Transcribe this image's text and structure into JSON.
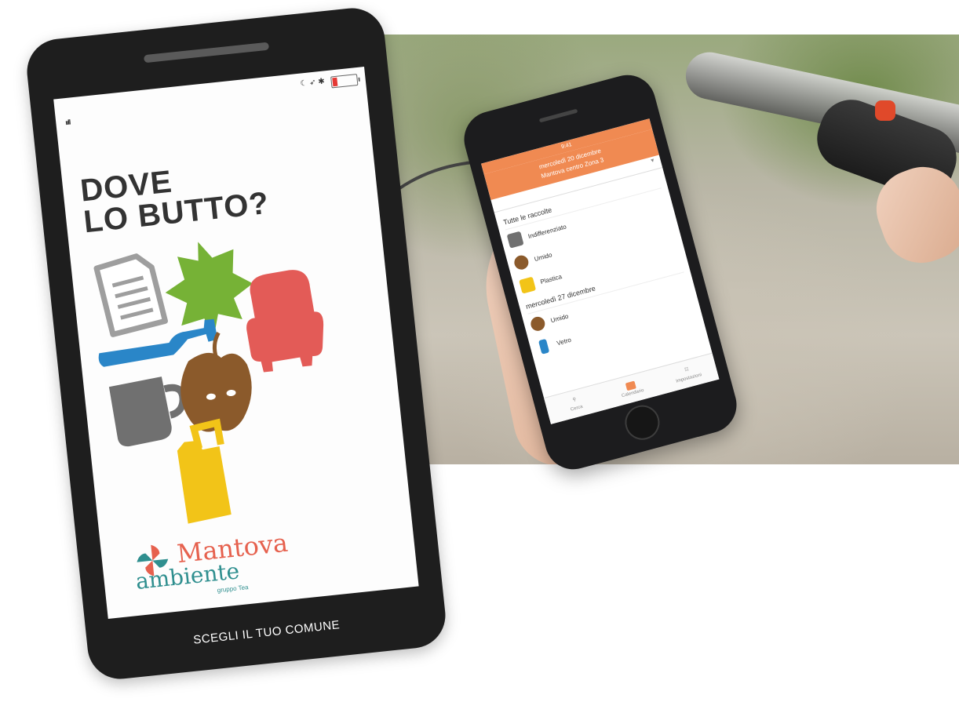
{
  "big_phone": {
    "signal": "ııll",
    "status_icons": "☾ ➶ ✱",
    "title_line1": "DOVE",
    "title_line2": "LO BUTTO?",
    "illustration": {
      "paper": "#9e9e9e",
      "leaf": "#76b236",
      "armchair": "#e35b57",
      "bottle": "#2a86c8",
      "mug": "#707070",
      "apple": "#8b5a2b",
      "jerrycan": "#f2c418"
    },
    "logo": {
      "line1": "Mantova",
      "line2": "ambiente",
      "sub": "gruppo Tea"
    },
    "cta": "SCEGLI IL TUO COMUNE"
  },
  "small_phone": {
    "status_time": "9:41",
    "header_line1": "mercoledì 20 dicembre",
    "header_line2": "Mantova centro Zona 3",
    "section1": "Tutte le raccolte",
    "rows1": [
      {
        "label": "Indifferenziato",
        "color": "#707070"
      },
      {
        "label": "Umido",
        "color": "#8b5a2b"
      },
      {
        "label": "Plastica",
        "color": "#f2c418"
      }
    ],
    "section2": "mercoledì 27 dicembre",
    "rows2": [
      {
        "label": "Umido",
        "color": "#8b5a2b"
      },
      {
        "label": "Vetro",
        "color": "#2a86c8"
      }
    ],
    "tabs": [
      "Cerca",
      "Calendario",
      "Impostazioni"
    ]
  },
  "colors": {
    "accent_orange": "#f08a52",
    "phone_body": "#1e1e1e"
  }
}
